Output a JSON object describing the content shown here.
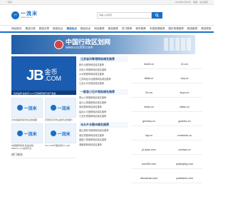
{
  "topbar": {
    "left": "一流米",
    "right": [
      "2024年11月30日",
      "收藏",
      "设为首页"
    ]
  },
  "logo": {
    "mark": "一",
    "name": "一流米",
    "sub": "www.1jon.cn"
  },
  "search": {
    "placeholder": "请输入关键词"
  },
  "nav": [
    "网站首页",
    "精选分类",
    "精选文章",
    "精选站点",
    "精品站点",
    "精品站点",
    "网站推荐",
    "精品推荐",
    "热门推荐",
    "城市推荐",
    "中国资源推荐",
    "国外资源推荐",
    "精选推荐",
    "精选导航"
  ],
  "nav_active": 4,
  "banner": {
    "title": "中国行政区划网",
    "sub": "www.ccc200.com"
  },
  "jb": {
    "brand": "JB",
    "cn": "金币",
    "dom": ".COM",
    "caption": "投资品牌:金金币.com 已经拥有数字资产金融"
  },
  "cards": [
    {
      "title": "一流米",
      "text": "日本漫画风格手绘鸟类插图"
    },
    {
      "title": "一流米",
      "text": "农田和无尽的山脉景点的图片"
    },
    {
      "title": "一流米",
      "text": "中国国际物流,商品运输PBank.com,运营平台"
    },
    {
      "title": "一流米",
      "text": "XG.COM平面包装(Pro-48)"
    }
  ],
  "section_title": "热门域名",
  "blocks": [
    {
      "title": "江苏省风筝港网站域名推荐",
      "items": [
        "新乐业推荐网站域名推荐",
        "天府小重推荐网站域名推荐",
        "乡洲重推荐网站域名推荐",
        "江苏网站平台推荐网站域名推荐",
        "江武乡天关网站域名推荐"
      ]
    },
    {
      "title": "一群县小石乡网站域名推荐",
      "items": [
        "香乡小重推荐网站域名推荐",
        "晨小山重推荐网站域名推荐",
        "量优推荐网站域名推荐",
        "建武乡平推荐网站域名推荐",
        "江汤天重推荐网站域名推荐"
      ]
    },
    {
      "title": "冰水乡长朝州域名推荐",
      "items": [
        "雷山港有中推荐网站域名推荐",
        "城仓重推荐网站域名推荐",
        "国盈小重推荐网站域名推荐",
        "湖南推荐网站域名推荐"
      ]
    }
  ],
  "domains": [
    "tea43.cn",
    "21c.cn",
    "68dir.cn",
    "xinji.cn",
    "21c.cn",
    "sicyu.cn",
    "shiclu.cn",
    "zfluku.cn",
    "geclhao.cn",
    "gushiku.cn",
    "hqt.cn",
    "cnminhzu.cn",
    "pLayke.com",
    "cnwhao.cn",
    "com300.com",
    "ipdianying.com",
    "dexuamao.com",
    "yoxiidame.com"
  ]
}
